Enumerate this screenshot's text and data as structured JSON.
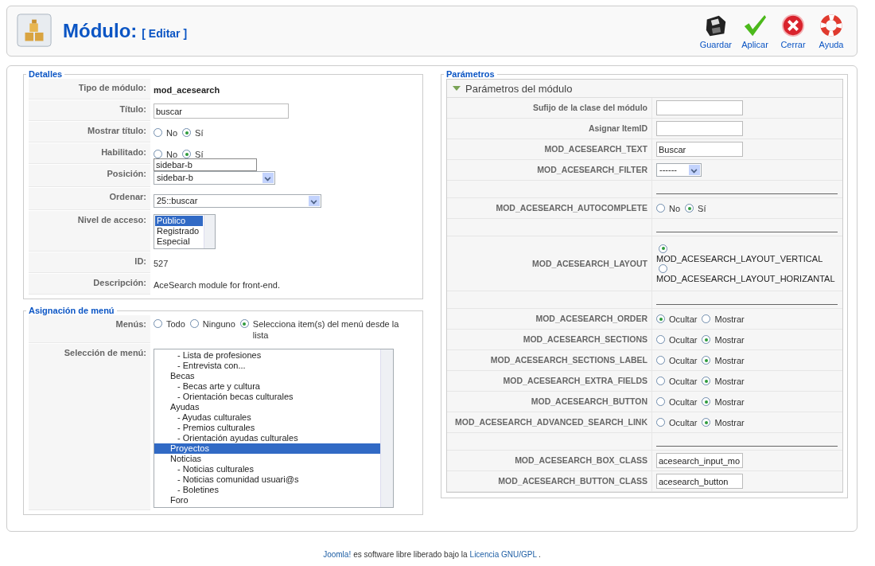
{
  "header": {
    "title": "Módulo:",
    "subtitle": "[ Editar ]",
    "toolbar": [
      {
        "label": "Guardar",
        "kind": "save"
      },
      {
        "label": "Aplicar",
        "kind": "apply"
      },
      {
        "label": "Cerrar",
        "kind": "close"
      },
      {
        "label": "Ayuda",
        "kind": "help"
      }
    ]
  },
  "details": {
    "legend": "Detalles",
    "rows": [
      {
        "label": "Tipo de módulo:",
        "kind": "strong",
        "value": "mod_acesearch"
      },
      {
        "label": "Título:",
        "kind": "input",
        "value": "buscar"
      },
      {
        "label": "Mostrar título:",
        "kind": "radio",
        "options": [
          {
            "label": "No",
            "selected": false
          },
          {
            "label": "Sí",
            "selected": true
          }
        ]
      },
      {
        "label": "Habilitado:",
        "kind": "radio",
        "options": [
          {
            "label": "No",
            "selected": false
          },
          {
            "label": "Sí",
            "selected": true
          }
        ]
      },
      {
        "label": "Posición:",
        "kind": "select",
        "value": "sidebar-b",
        "suggestion": "sidebar-b"
      },
      {
        "label": "Ordenar:",
        "kind": "select",
        "value": "25::buscar"
      },
      {
        "label": "Nivel de acceso:",
        "kind": "listbox",
        "options": [
          {
            "label": "Público",
            "selected": true
          },
          {
            "label": "Registrado",
            "selected": false
          },
          {
            "label": "Especial",
            "selected": false
          }
        ]
      },
      {
        "label": "ID:",
        "kind": "text",
        "value": "527"
      },
      {
        "label": "Descripción:",
        "kind": "text",
        "value": "AceSearch module for front-end."
      }
    ]
  },
  "menu_assignment": {
    "legend": "Asignación de menú",
    "rows": [
      {
        "label": "Menús:",
        "kind": "radio",
        "options": [
          {
            "label": "Todo",
            "selected": false
          },
          {
            "label": "Ninguno",
            "selected": false
          },
          {
            "label": "Selecciona item(s) del menú desde la lista",
            "selected": true
          }
        ]
      },
      {
        "label": "Selección de menú:",
        "kind": "tree",
        "items": [
          {
            "children": [
              {
                "label": "- Lista de profesiones",
                "selected": false
              },
              {
                "label": "- Entrevista con...",
                "selected": false
              }
            ]
          },
          {
            "label": "Becas",
            "selected": false,
            "children": [
              {
                "label": "- Becas arte y cultura",
                "selected": false
              },
              {
                "label": "- Orientación becas culturales",
                "selected": false
              }
            ]
          },
          {
            "label": "Ayudas",
            "selected": false,
            "children": [
              {
                "label": "- Ayudas culturales",
                "selected": false
              },
              {
                "label": "- Premios culturales",
                "selected": false
              },
              {
                "label": "- Orientación ayudas culturales",
                "selected": false
              }
            ]
          },
          {
            "label": "Proyectos",
            "selected": true
          },
          {
            "label": "Noticias",
            "selected": false,
            "children": [
              {
                "label": "- Noticias culturales",
                "selected": false
              },
              {
                "label": "- Noticias comunidad usuari@s",
                "selected": false
              },
              {
                "label": "- Boletines",
                "selected": false
              }
            ]
          },
          {
            "label": "Foro",
            "selected": false
          }
        ]
      }
    ]
  },
  "parameters": {
    "legend": "Parámetros",
    "panel_title": "Parámetros del módulo",
    "expanded": true,
    "rows": [
      {
        "label": "Sufijo de la clase del módulo",
        "kind": "input"
      },
      {
        "label": "Asignar ItemID",
        "kind": "input"
      },
      {
        "label": "MOD_ACESEARCH_TEXT",
        "kind": "input",
        "value": "Buscar"
      },
      {
        "label": "MOD_ACESEARCH_FILTER",
        "kind": "select",
        "value": "------"
      },
      {
        "kind": "separator"
      },
      {
        "label": "MOD_ACESEARCH_AUTOCOMPLETE",
        "kind": "radio",
        "options": [
          {
            "label": "No",
            "selected": false
          },
          {
            "label": "Sí",
            "selected": true
          }
        ]
      },
      {
        "kind": "separator"
      },
      {
        "label": "MOD_ACESEARCH_LAYOUT",
        "kind": "radio_stack",
        "options": [
          {
            "label": "MOD_ACESEARCH_LAYOUT_VERTICAL",
            "selected": true
          },
          {
            "label": "MOD_ACESEARCH_LAYOUT_HORIZANTAL",
            "selected": false
          }
        ]
      },
      {
        "kind": "separator"
      },
      {
        "label": "MOD_ACESEARCH_ORDER",
        "kind": "radio",
        "options": [
          {
            "label": "Ocultar",
            "selected": true
          },
          {
            "label": "Mostrar",
            "selected": false
          }
        ]
      },
      {
        "label": "MOD_ACESEARCH_SECTIONS",
        "kind": "radio",
        "options": [
          {
            "label": "Ocultar",
            "selected": false
          },
          {
            "label": "Mostrar",
            "selected": true
          }
        ]
      },
      {
        "label": "MOD_ACESEARCH_SECTIONS_LABEL",
        "kind": "radio",
        "options": [
          {
            "label": "Ocultar",
            "selected": false
          },
          {
            "label": "Mostrar",
            "selected": true
          }
        ]
      },
      {
        "label": "MOD_ACESEARCH_EXTRA_FIELDS",
        "kind": "radio",
        "options": [
          {
            "label": "Ocultar",
            "selected": false
          },
          {
            "label": "Mostrar",
            "selected": true
          }
        ]
      },
      {
        "label": "MOD_ACESEARCH_BUTTON",
        "kind": "radio",
        "options": [
          {
            "label": "Ocultar",
            "selected": false
          },
          {
            "label": "Mostrar",
            "selected": true
          }
        ]
      },
      {
        "label": "MOD_ACESEARCH_ADVANCED_SEARCH_LINK",
        "kind": "radio",
        "options": [
          {
            "label": "Ocultar",
            "selected": false
          },
          {
            "label": "Mostrar",
            "selected": true
          }
        ]
      },
      {
        "kind": "separator"
      },
      {
        "label": "MOD_ACESEARCH_BOX_CLASS",
        "kind": "input",
        "value": "acesearch_input_mo"
      },
      {
        "label": "MOD_ACESEARCH_BUTTON_CLASS",
        "kind": "input",
        "value": "acesearch_button"
      }
    ]
  },
  "footer": [
    {
      "text": "Joomla!",
      "kind": "link"
    },
    {
      "text": "es software libre liberado bajo la",
      "kind": "text"
    },
    {
      "text": "Licencia GNU/GPL",
      "kind": "link"
    },
    {
      "text": ".",
      "kind": "text"
    }
  ]
}
